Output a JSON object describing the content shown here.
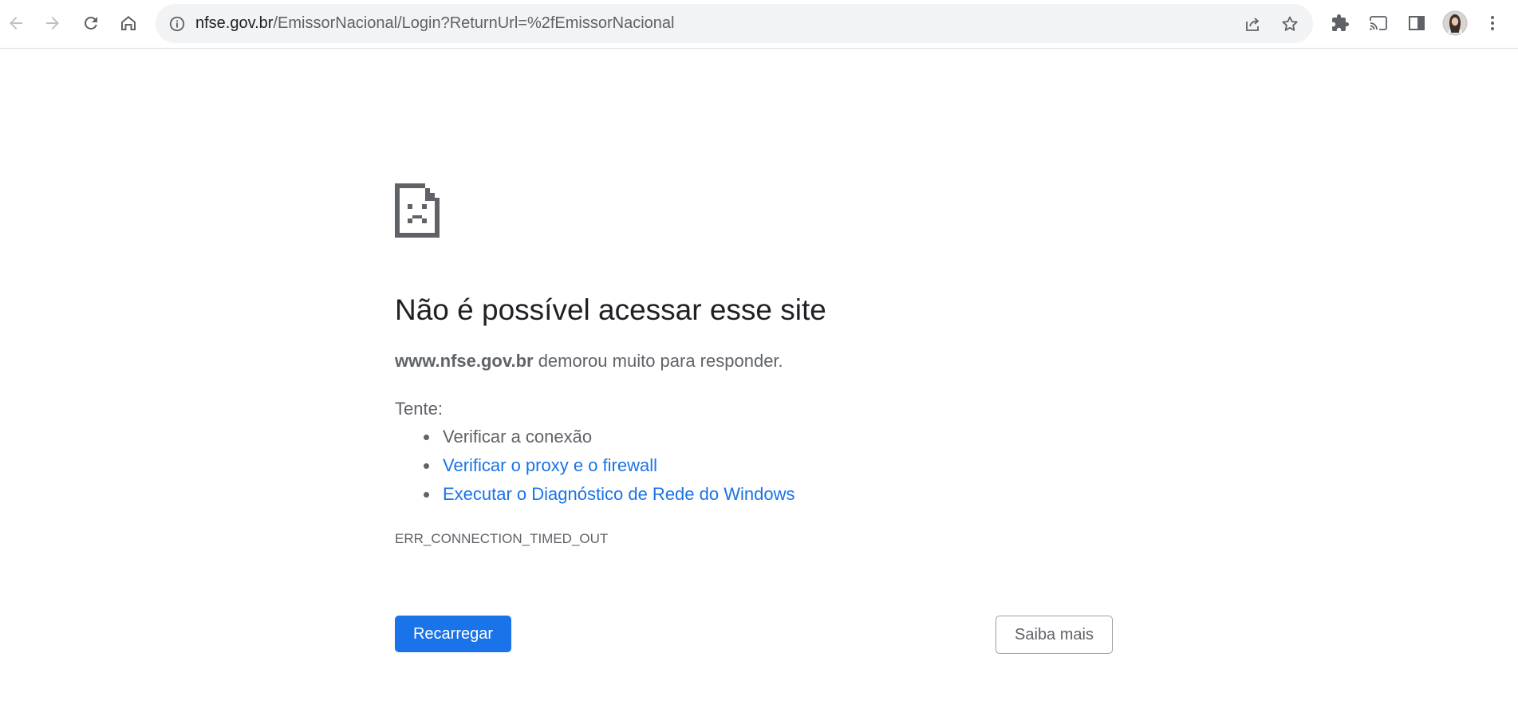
{
  "browser": {
    "url_host": "nfse.gov.br",
    "url_path": "/EmissorNacional/Login?ReturnUrl=%2fEmissorNacional",
    "icons": {
      "back": "back-arrow-icon",
      "forward": "forward-arrow-icon",
      "reload": "reload-icon",
      "home": "home-icon",
      "site_info": "info-icon",
      "share": "share-icon",
      "bookmark": "star-icon",
      "extensions": "puzzle-icon",
      "cast": "cast-icon",
      "side_panel": "side-panel-icon",
      "profile": "avatar",
      "menu": "kebab-menu-icon"
    }
  },
  "error_page": {
    "icon": "sad-document-icon",
    "title": "Não é possível acessar esse site",
    "summary_host": "www.nfse.gov.br",
    "summary_text": " demorou muito para responder.",
    "try_label": "Tente:",
    "suggestions": [
      "Verificar a conexão",
      "Verificar o proxy e o firewall",
      "Executar o Diagnóstico de Rede do Windows"
    ],
    "error_code": "ERR_CONNECTION_TIMED_OUT",
    "reload_label": "Recarregar",
    "more_label": "Saiba mais"
  },
  "colors": {
    "accent": "#1a73e8",
    "text_primary": "#202124",
    "text_secondary": "#5f6368",
    "omnibox_bg": "#f1f3f4"
  }
}
